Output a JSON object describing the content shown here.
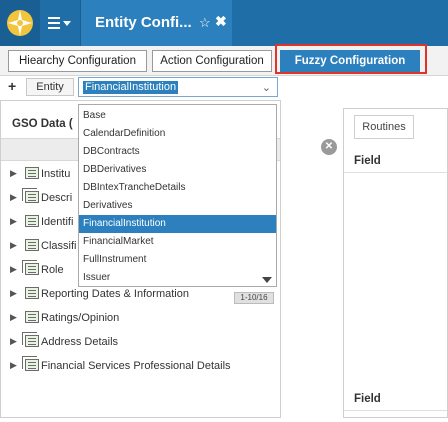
{
  "window": {
    "title": "Entity Confi...",
    "star_icon": "star-outline-icon",
    "close_icon": "close-icon"
  },
  "tabs": [
    {
      "label": "Hiearchy Configuration",
      "active": false
    },
    {
      "label": "Action Configuration",
      "active": false
    },
    {
      "label": "Fuzzy Configuration",
      "active": true
    }
  ],
  "colors": {
    "titlebar": "#1f6ea8",
    "accent": "#2b80bd",
    "highlight": "#e0342b"
  },
  "entity": {
    "add_icon": "plus-icon",
    "label": "Entity",
    "value": "FinancialInstitution"
  },
  "dropdown": {
    "options": [
      "Base",
      "CalendarDefinition",
      "DBContracts",
      "DBDerivatives",
      "DBIntexTrancheDetails",
      "Derivatives",
      "FinancialInstitution",
      "FinancialMarket",
      "FullInstrument",
      "Issuer"
    ],
    "selected": "FinancialInstitution"
  },
  "left_panel": {
    "title": "GSO Data (",
    "tree": [
      {
        "label": "Institu",
        "icon": "list-icon"
      },
      {
        "label": "Descri",
        "icon": "stack-icon"
      },
      {
        "label": "Identifi",
        "icon": "list-icon"
      },
      {
        "label": "Classifi",
        "icon": "list-icon"
      },
      {
        "label": "Role",
        "icon": "stack-icon"
      },
      {
        "label": "Reporting Dates & Information",
        "icon": "list-icon"
      },
      {
        "label": "Ratings/Opinion",
        "icon": "list-icon"
      },
      {
        "label": "Address Details",
        "icon": "stack-icon"
      },
      {
        "label": "Financial Services Professional Details",
        "icon": "stack-icon"
      }
    ],
    "pager": "1-10/16"
  },
  "right_panel": {
    "routines_label": "Routines",
    "field_label_1": "Field",
    "field_label_2": "Field"
  }
}
